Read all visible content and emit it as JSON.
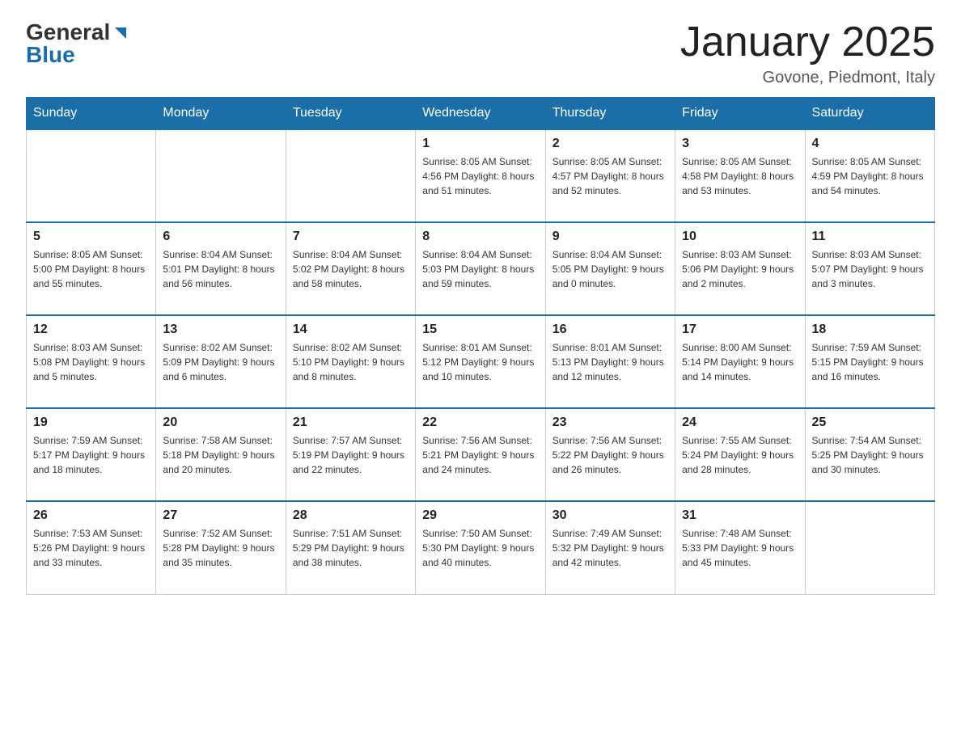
{
  "header": {
    "logo": {
      "general": "General",
      "blue": "Blue",
      "triangle": "▶"
    },
    "title": "January 2025",
    "location": "Govone, Piedmont, Italy"
  },
  "days_of_week": [
    "Sunday",
    "Monday",
    "Tuesday",
    "Wednesday",
    "Thursday",
    "Friday",
    "Saturday"
  ],
  "weeks": [
    [
      {
        "day": "",
        "info": ""
      },
      {
        "day": "",
        "info": ""
      },
      {
        "day": "",
        "info": ""
      },
      {
        "day": "1",
        "info": "Sunrise: 8:05 AM\nSunset: 4:56 PM\nDaylight: 8 hours\nand 51 minutes."
      },
      {
        "day": "2",
        "info": "Sunrise: 8:05 AM\nSunset: 4:57 PM\nDaylight: 8 hours\nand 52 minutes."
      },
      {
        "day": "3",
        "info": "Sunrise: 8:05 AM\nSunset: 4:58 PM\nDaylight: 8 hours\nand 53 minutes."
      },
      {
        "day": "4",
        "info": "Sunrise: 8:05 AM\nSunset: 4:59 PM\nDaylight: 8 hours\nand 54 minutes."
      }
    ],
    [
      {
        "day": "5",
        "info": "Sunrise: 8:05 AM\nSunset: 5:00 PM\nDaylight: 8 hours\nand 55 minutes."
      },
      {
        "day": "6",
        "info": "Sunrise: 8:04 AM\nSunset: 5:01 PM\nDaylight: 8 hours\nand 56 minutes."
      },
      {
        "day": "7",
        "info": "Sunrise: 8:04 AM\nSunset: 5:02 PM\nDaylight: 8 hours\nand 58 minutes."
      },
      {
        "day": "8",
        "info": "Sunrise: 8:04 AM\nSunset: 5:03 PM\nDaylight: 8 hours\nand 59 minutes."
      },
      {
        "day": "9",
        "info": "Sunrise: 8:04 AM\nSunset: 5:05 PM\nDaylight: 9 hours\nand 0 minutes."
      },
      {
        "day": "10",
        "info": "Sunrise: 8:03 AM\nSunset: 5:06 PM\nDaylight: 9 hours\nand 2 minutes."
      },
      {
        "day": "11",
        "info": "Sunrise: 8:03 AM\nSunset: 5:07 PM\nDaylight: 9 hours\nand 3 minutes."
      }
    ],
    [
      {
        "day": "12",
        "info": "Sunrise: 8:03 AM\nSunset: 5:08 PM\nDaylight: 9 hours\nand 5 minutes."
      },
      {
        "day": "13",
        "info": "Sunrise: 8:02 AM\nSunset: 5:09 PM\nDaylight: 9 hours\nand 6 minutes."
      },
      {
        "day": "14",
        "info": "Sunrise: 8:02 AM\nSunset: 5:10 PM\nDaylight: 9 hours\nand 8 minutes."
      },
      {
        "day": "15",
        "info": "Sunrise: 8:01 AM\nSunset: 5:12 PM\nDaylight: 9 hours\nand 10 minutes."
      },
      {
        "day": "16",
        "info": "Sunrise: 8:01 AM\nSunset: 5:13 PM\nDaylight: 9 hours\nand 12 minutes."
      },
      {
        "day": "17",
        "info": "Sunrise: 8:00 AM\nSunset: 5:14 PM\nDaylight: 9 hours\nand 14 minutes."
      },
      {
        "day": "18",
        "info": "Sunrise: 7:59 AM\nSunset: 5:15 PM\nDaylight: 9 hours\nand 16 minutes."
      }
    ],
    [
      {
        "day": "19",
        "info": "Sunrise: 7:59 AM\nSunset: 5:17 PM\nDaylight: 9 hours\nand 18 minutes."
      },
      {
        "day": "20",
        "info": "Sunrise: 7:58 AM\nSunset: 5:18 PM\nDaylight: 9 hours\nand 20 minutes."
      },
      {
        "day": "21",
        "info": "Sunrise: 7:57 AM\nSunset: 5:19 PM\nDaylight: 9 hours\nand 22 minutes."
      },
      {
        "day": "22",
        "info": "Sunrise: 7:56 AM\nSunset: 5:21 PM\nDaylight: 9 hours\nand 24 minutes."
      },
      {
        "day": "23",
        "info": "Sunrise: 7:56 AM\nSunset: 5:22 PM\nDaylight: 9 hours\nand 26 minutes."
      },
      {
        "day": "24",
        "info": "Sunrise: 7:55 AM\nSunset: 5:24 PM\nDaylight: 9 hours\nand 28 minutes."
      },
      {
        "day": "25",
        "info": "Sunrise: 7:54 AM\nSunset: 5:25 PM\nDaylight: 9 hours\nand 30 minutes."
      }
    ],
    [
      {
        "day": "26",
        "info": "Sunrise: 7:53 AM\nSunset: 5:26 PM\nDaylight: 9 hours\nand 33 minutes."
      },
      {
        "day": "27",
        "info": "Sunrise: 7:52 AM\nSunset: 5:28 PM\nDaylight: 9 hours\nand 35 minutes."
      },
      {
        "day": "28",
        "info": "Sunrise: 7:51 AM\nSunset: 5:29 PM\nDaylight: 9 hours\nand 38 minutes."
      },
      {
        "day": "29",
        "info": "Sunrise: 7:50 AM\nSunset: 5:30 PM\nDaylight: 9 hours\nand 40 minutes."
      },
      {
        "day": "30",
        "info": "Sunrise: 7:49 AM\nSunset: 5:32 PM\nDaylight: 9 hours\nand 42 minutes."
      },
      {
        "day": "31",
        "info": "Sunrise: 7:48 AM\nSunset: 5:33 PM\nDaylight: 9 hours\nand 45 minutes."
      },
      {
        "day": "",
        "info": ""
      }
    ]
  ],
  "colors": {
    "header_bg": "#1a6fa8",
    "border_top": "#1a6fa8",
    "border_cell": "#ccc",
    "logo_blue": "#1a6fa8",
    "text_dark": "#222",
    "text_mid": "#555"
  }
}
